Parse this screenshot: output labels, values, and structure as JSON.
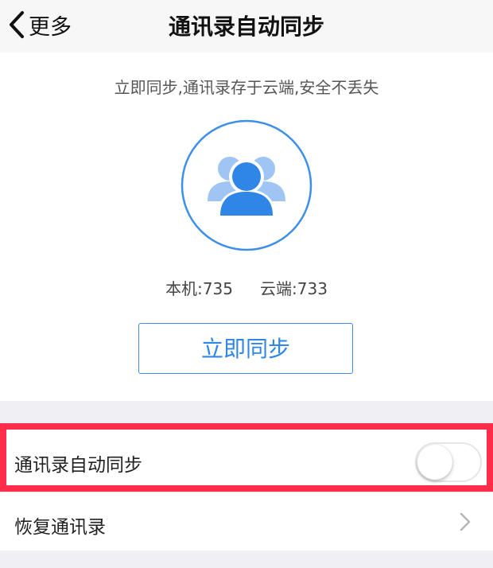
{
  "nav": {
    "back_label": "更多",
    "title": "通讯录自动同步"
  },
  "hero": {
    "tagline": "立即同步,通讯录存于云端,安全不丢失",
    "local_label": "本机:",
    "local_count": "735",
    "cloud_label": "云端:",
    "cloud_count": "733",
    "sync_button_label": "立即同步"
  },
  "settings": {
    "auto_sync_label": "通讯录自动同步",
    "auto_sync_enabled": false,
    "restore_label": "恢复通讯录"
  },
  "colors": {
    "accent": "#2f86e6",
    "highlight": "#ff2d4a",
    "background": "#efeff4"
  },
  "icons": {
    "back": "chevron-left-icon",
    "contacts": "contacts-group-icon",
    "restore_arrow": "chevron-right-icon"
  }
}
